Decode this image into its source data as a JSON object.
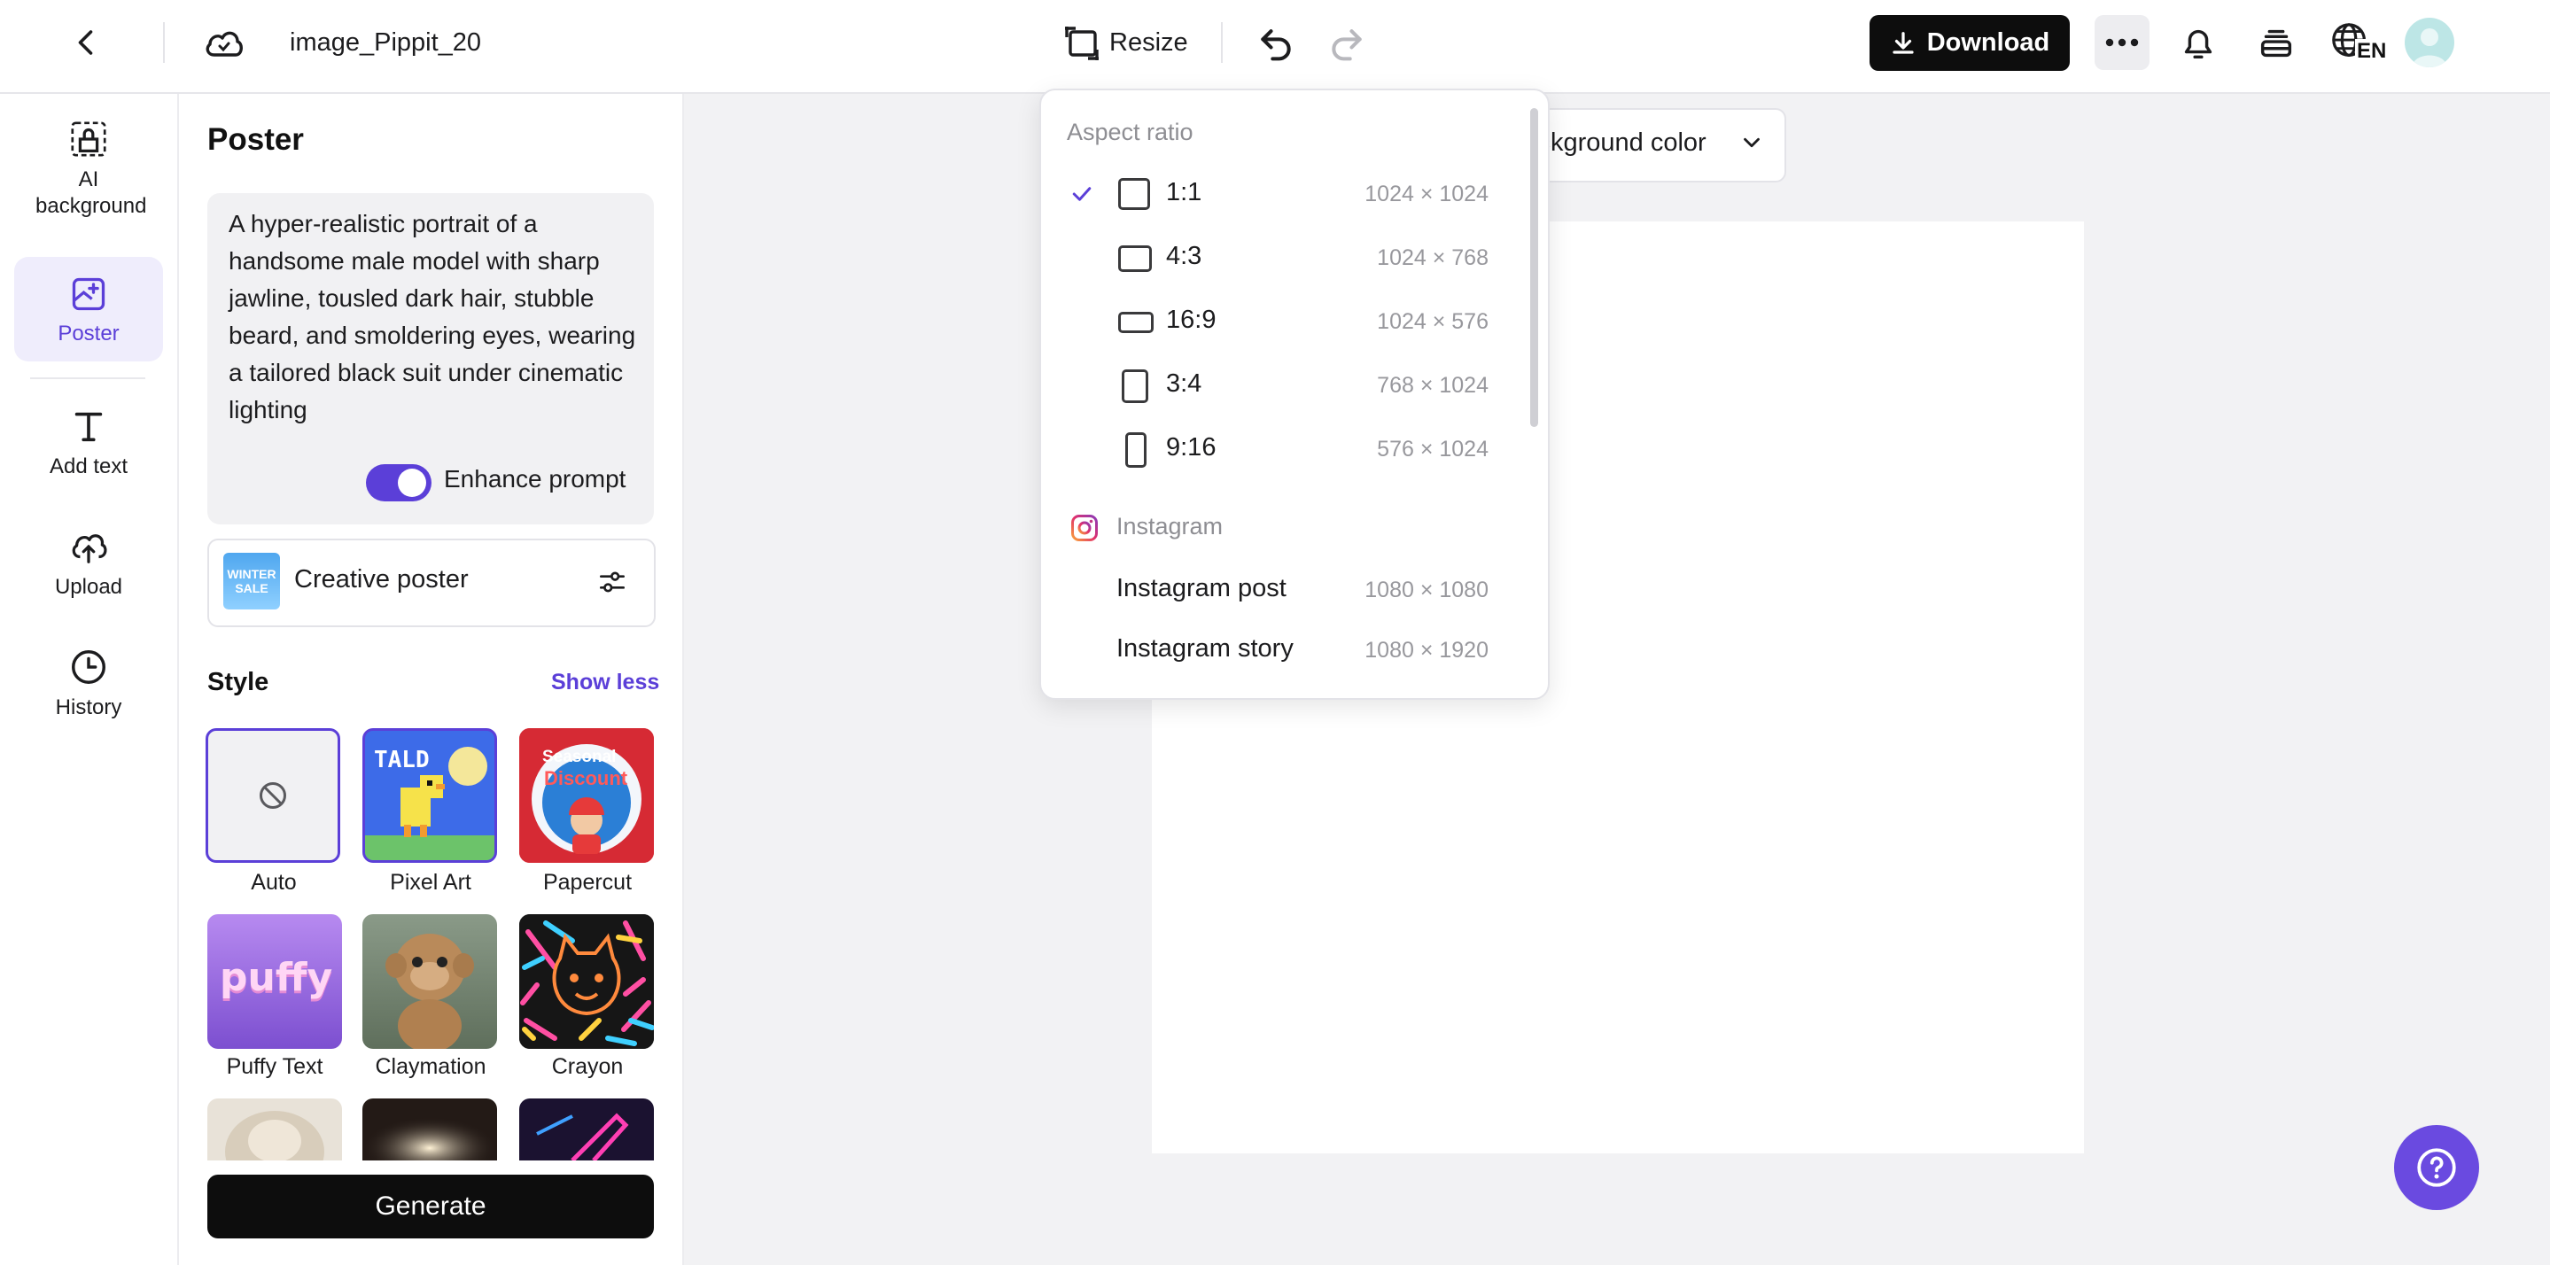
{
  "topbar": {
    "file_name": "image_Pippit_20",
    "resize_label": "Resize",
    "download_label": "Download",
    "language": "EN"
  },
  "rail": {
    "items": [
      {
        "label": "AI background",
        "icon": "ai-background-icon"
      },
      {
        "label": "Poster",
        "icon": "poster-icon",
        "active": true
      },
      {
        "label": "Add text",
        "icon": "text-icon"
      },
      {
        "label": "Upload",
        "icon": "cloud-upload-icon"
      },
      {
        "label": "History",
        "icon": "clock-icon"
      }
    ]
  },
  "panel": {
    "title": "Poster",
    "prompt": "A hyper-realistic portrait of a handsome male model with sharp jawline, tousled dark hair, stubble beard, and smoldering eyes, wearing a tailored black suit under cinematic lighting",
    "enhance_label": "Enhance prompt",
    "enhance_on": true,
    "template_thumb_text": "WINTER SALE",
    "template_label": "Creative poster",
    "style_title": "Style",
    "show_less": "Show less",
    "styles": [
      {
        "label": "Auto",
        "selected": true
      },
      {
        "label": "Pixel Art"
      },
      {
        "label": "Papercut"
      },
      {
        "label": "Puffy Text"
      },
      {
        "label": "Claymation"
      },
      {
        "label": "Crayon"
      }
    ],
    "style_thumb_text": {
      "pixel_art": "TALD",
      "papercut_line1": "Seasonal",
      "papercut_line2": "Discount",
      "puffy": "puffy"
    },
    "generate_label": "Generate"
  },
  "canvas": {
    "bg_color_label": "Background color"
  },
  "resize_menu": {
    "aspect_heading": "Aspect ratio",
    "ratios": [
      {
        "label": "1:1",
        "size": "1024 × 1024",
        "checked": true
      },
      {
        "label": "4:3",
        "size": "1024 × 768"
      },
      {
        "label": "16:9",
        "size": "1024 × 576"
      },
      {
        "label": "3:4",
        "size": "768 × 1024"
      },
      {
        "label": "9:16",
        "size": "576 × 1024"
      }
    ],
    "instagram_heading": "Instagram",
    "instagram": [
      {
        "label": "Instagram post",
        "size": "1080 × 1080"
      },
      {
        "label": "Instagram story",
        "size": "1080 × 1920"
      }
    ]
  },
  "colors": {
    "accent": "#5b3fd8",
    "help_button": "#6a4ae0",
    "dark_button": "#0d0d0d"
  }
}
